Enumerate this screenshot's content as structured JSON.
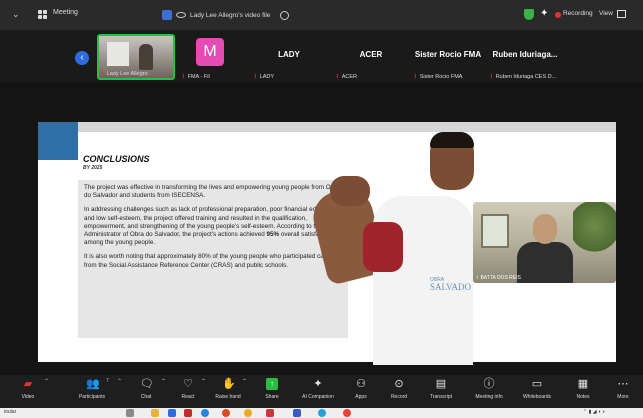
{
  "titlebar": {
    "app_name": "Meeting",
    "view_tab": "Lady Lee Allegro's video file",
    "recording": "Recording",
    "view": "View"
  },
  "participants": [
    {
      "name": "",
      "label": "Lady Lee Allegro",
      "has_video": true
    },
    {
      "name": "",
      "label": "FMA - Fil",
      "avatar_letter": "M",
      "avatar_color": "#e54bb2"
    },
    {
      "name": "LADY",
      "label": "LADY"
    },
    {
      "name": "ACER",
      "label": "ACER"
    },
    {
      "name": "Sister Rocio FMA",
      "label": "Sister Rocio FMA"
    },
    {
      "name": "Ruben Iduriaga...",
      "label": "Ruben Iduriaga CES D..."
    }
  ],
  "slide": {
    "title": "CONCLUSIONS",
    "subtitle": "BY 2025",
    "paragraph_1": "The project was effective in transforming the lives and empowering young people from Obra do Salvador and students from ISECENSA.",
    "paragraph_2_before": "In addressing challenges such as lack of professional preparation, poor financial education, and low self-esteem, the project offered training and resulted in the qualification, empowerment, and strengthening of the young people's self-esteem. According to the Administrator of Obra do Salvador, the project's actions achieved ",
    "paragraph_2_bold": "95%",
    "paragraph_2_after": " overall satisfaction among the young people.",
    "paragraph_3": "It is also worth noting that approximately 80% of the young people who participated came from the Social Assistance Reference Center (CRAS) and public schools.",
    "logo_small": "OBRA",
    "logo_big": "SALVADO"
  },
  "self_view": {
    "label": "BATTA DOS REIS"
  },
  "toolbar": {
    "video": "Video",
    "participants": "Participants",
    "participants_count": "7",
    "chat": "Chat",
    "react": "React",
    "raise_hand": "Raise hand",
    "share": "Share",
    "ai_companion": "AI Companion",
    "apps": "Apps",
    "record": "Record",
    "transcript": "Transcript",
    "meeting_info": "Meeting info",
    "whiteboards": "Whiteboards",
    "notes": "Notes",
    "more": "More"
  },
  "taskbar": {
    "search": "ioular"
  },
  "colors": {
    "accent": "#2d6cdf",
    "active_speaker": "#27c03e",
    "muted": "#e0322e",
    "slide_accent": "#2f6fa6"
  }
}
